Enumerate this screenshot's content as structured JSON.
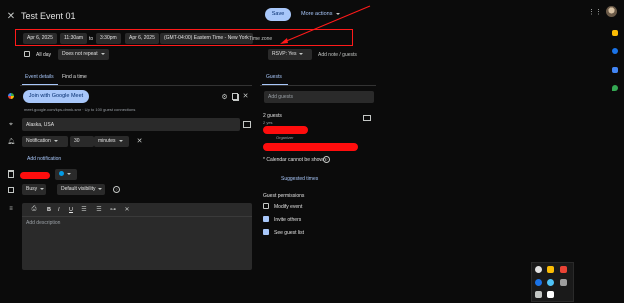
{
  "header": {
    "title": "Test Event 01",
    "save_label": "Save",
    "more_actions_label": "More actions"
  },
  "datetime": {
    "start_date": "Apr 6, 2025",
    "start_time": "11:30am",
    "to_label": "to",
    "end_time": "3:30pm",
    "end_date": "Apr 6, 2025",
    "timezone_value": "(GMT-04:00) Eastern Time - New York",
    "timezone_link": "Time zone"
  },
  "options": {
    "all_day_label": "All day",
    "repeat_value": "Does not repeat"
  },
  "tabs": {
    "event_details": "Event details",
    "find_time": "Find a time"
  },
  "meet": {
    "join_label": "Join with Google Meet",
    "info": "meet.google.com/kps-dmnk-smr · Up to 100 guest connections"
  },
  "location": {
    "value": "Alaska, USA"
  },
  "notification": {
    "type": "Notification",
    "amount": "30",
    "unit": "minutes",
    "add_label": "Add notification"
  },
  "calendar": {
    "status": "Busy",
    "visibility": "Default visibility"
  },
  "description": {
    "placeholder": "Add description",
    "toolbar": [
      "B",
      "I",
      "U"
    ]
  },
  "rsvp": {
    "label": "RSVP: Yes",
    "add_note": "Add note / guests"
  },
  "guests": {
    "section_title": "Guests",
    "add_placeholder": "Add guests",
    "count": "2 guests",
    "yes_count": "2 yes",
    "organizer_label": "Organizer",
    "calendar_warning": "* Calendar cannot be shown",
    "suggested_times": "Suggested times",
    "permissions_title": "Guest permissions",
    "permissions": [
      {
        "label": "Modify event",
        "checked": false
      },
      {
        "label": "Invite others",
        "checked": true
      },
      {
        "label": "See guest list",
        "checked": true
      }
    ]
  },
  "colors": {
    "accent": "#a8c7fa",
    "redaction": "#ff0d0d",
    "annotation": "#ff1a1a",
    "event_color": "#039be5"
  }
}
